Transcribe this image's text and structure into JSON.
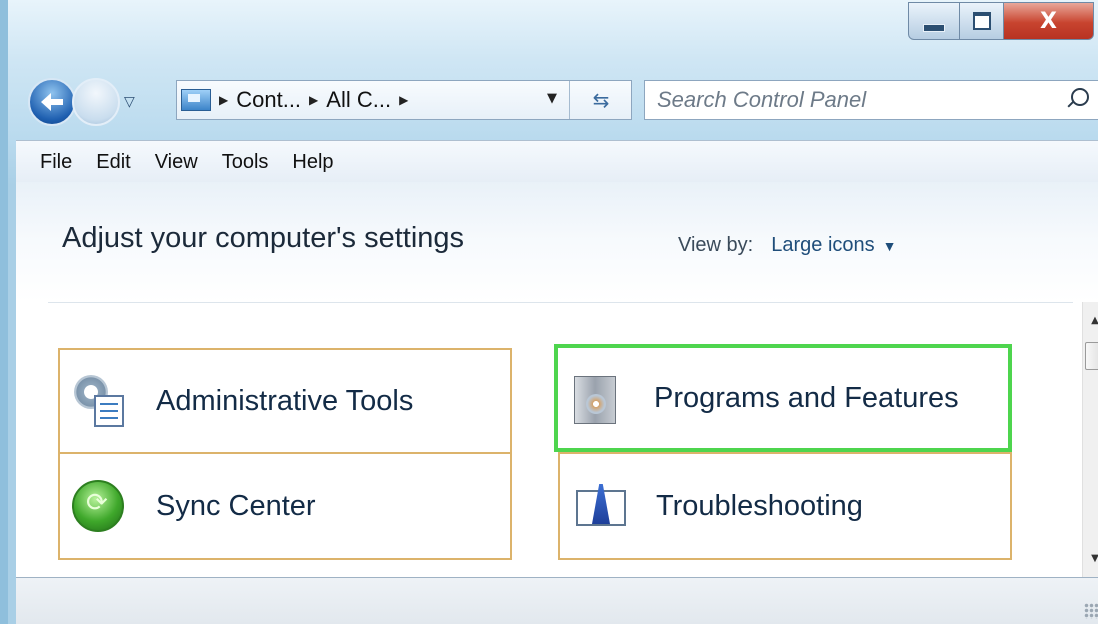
{
  "window": {
    "caption_buttons": {
      "minimize": "",
      "maximize": "",
      "close": "X"
    }
  },
  "nav": {
    "breadcrumbs": [
      "Cont...",
      "All C..."
    ],
    "search_placeholder": "Search Control Panel"
  },
  "menu": [
    "File",
    "Edit",
    "View",
    "Tools",
    "Help"
  ],
  "header": {
    "title": "Adjust your computer's settings",
    "view_by_label": "View by:",
    "view_by_value": "Large icons"
  },
  "items": [
    {
      "label": "Administrative Tools",
      "icon": "admin-tools-icon"
    },
    {
      "label": "Programs and Features",
      "icon": "programs-features-icon",
      "highlight_color": "#4ed54e"
    },
    {
      "label": "Sync Center",
      "icon": "sync-center-icon"
    },
    {
      "label": "Troubleshooting",
      "icon": "troubleshooting-icon"
    }
  ],
  "colors": {
    "item_border": "#dcb36b",
    "highlight": "#4ed54e",
    "close_button": "#c8442f"
  }
}
